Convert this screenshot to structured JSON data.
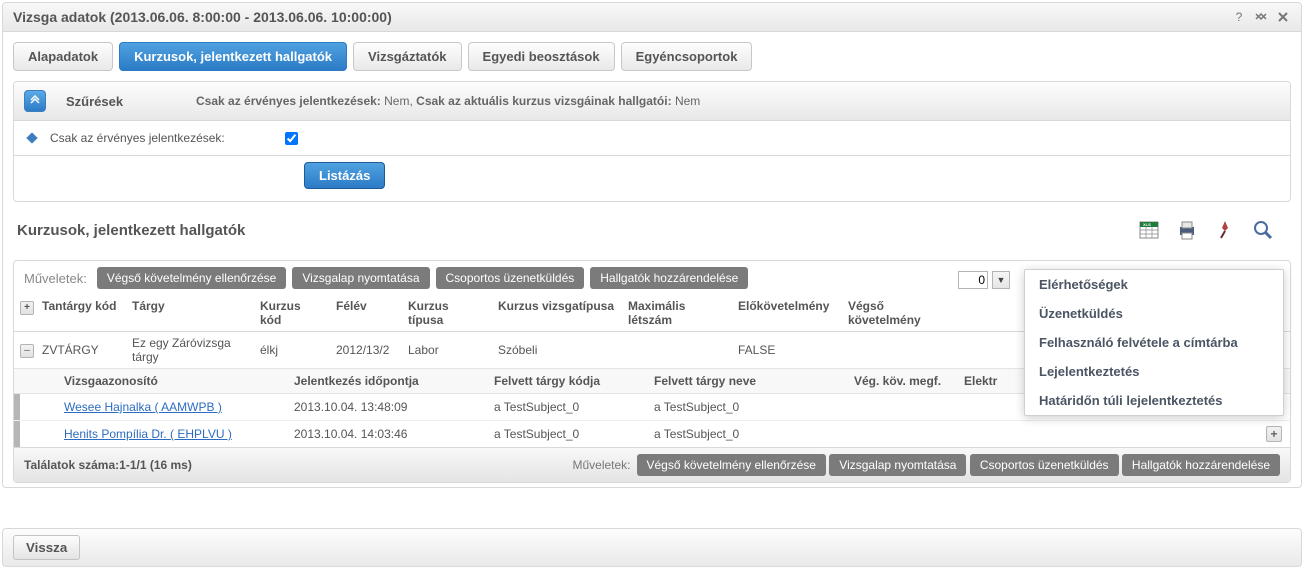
{
  "window": {
    "title": "Vizsga adatok (2013.06.06. 8:00:00 - 2013.06.06. 10:00:00)"
  },
  "tabs": [
    "Alapadatok",
    "Kurzusok, jelentkezett hallgatók",
    "Vizsgáztatók",
    "Egyedi beosztások",
    "Egyéncsoportok"
  ],
  "filter": {
    "heading": "Szűrések",
    "summary_a": "Csak az érvényes jelentkezések:",
    "summary_a_val": "Nem",
    "summary_b": "Csak az aktuális kurzus vizsgáinak hallgatói:",
    "summary_b_val": "Nem",
    "checkbox_label": "Csak az érvényes jelentkezések:",
    "listbtn": "Listázás"
  },
  "section_title": "Kurzusok, jelentkezett hallgatók",
  "ops_label": "Műveletek:",
  "ops": [
    "Végső követelmény ellenőrzése",
    "Vizsgalap nyomtatása",
    "Csoportos üzenetküldés",
    "Hallgatók hozzárendelése"
  ],
  "page_value": "0",
  "columns": [
    "Tantárgy kód",
    "Tárgy",
    "Kurzus kód",
    "Félév",
    "Kurzus típusa",
    "Kurzus vizsgatípusa",
    "Maximális létszám",
    "Előkövetelmény",
    "Végső követelmény"
  ],
  "row": {
    "subject_code": "ZVTÁRGY",
    "subject": "Ez egy Záróvizsga tárgy",
    "course_code": "élkj",
    "term": "2012/13/2",
    "course_type": "Labor",
    "exam_type": "Szóbeli",
    "maxnum": "",
    "prereq": "FALSE",
    "finalreq": ""
  },
  "subcolumns": [
    "Vizsgaazonosító",
    "Jelentkezés időpontja",
    "Felvett tárgy kódja",
    "Felvett tárgy neve",
    "Vég. köv. megf.",
    "Elektr"
  ],
  "subrows": [
    {
      "id": "Wesee Hajnalka ( AAMWPB )",
      "time": "2013.10.04. 13:48:09",
      "code": "a TestSubject_0",
      "name": "a TestSubject_0"
    },
    {
      "id": "Henits Pompília Dr. ( EHPLVU )",
      "time": "2013.10.04. 14:03:46",
      "code": "a TestSubject_0",
      "name": "a TestSubject_0"
    }
  ],
  "results": "Találatok száma:1-1/1 (16 ms)",
  "dropdown": [
    "Elérhetőségek",
    "Üzenetküldés",
    "Felhasználó felvétele a címtárba",
    "Lejelentkeztetés",
    "Határidőn túli lejelentkeztetés"
  ],
  "back": "Vissza"
}
